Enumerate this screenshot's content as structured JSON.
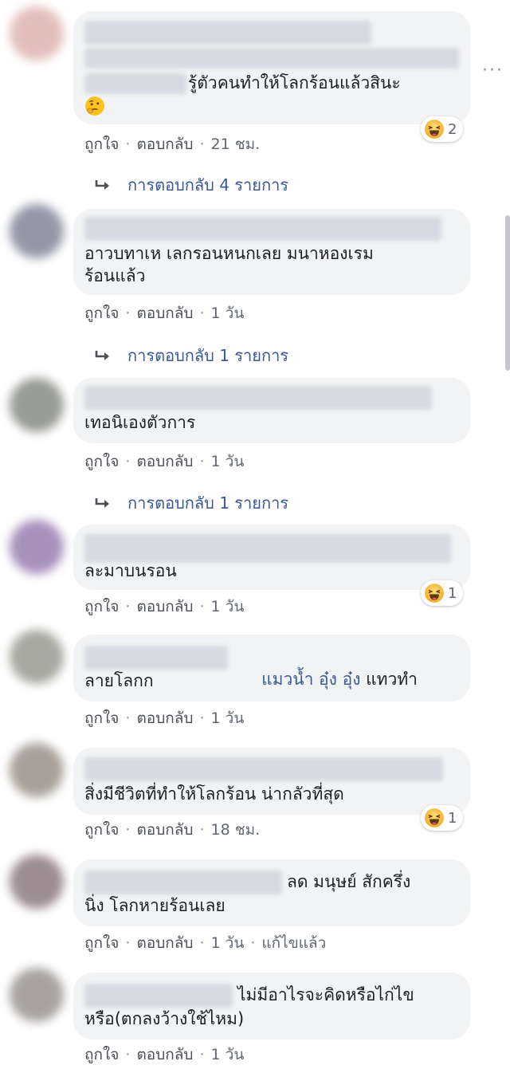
{
  "actions": {
    "like": "ถูกใจ",
    "reply": "ตอบกลับ",
    "separator": "·",
    "more": "···"
  },
  "comments": [
    {
      "text": "รู้ตัวคนทำให้โลกร้อนแล้วสินะ",
      "time": "21 ชม.",
      "reaction_count": "2",
      "replies": "การตอบกลับ 4 รายการ"
    },
    {
      "text": "อาวบทาเห เลกรอนหนกเลย มนาหองเรม\nร้อนแล้ว",
      "time": "1 วัน",
      "replies": "การตอบกลับ 1 รายการ"
    },
    {
      "text": "เทอนิเองตัวการ",
      "time": "1 วัน",
      "replies": "การตอบกลับ 1 รายการ"
    },
    {
      "text": "ละมาบนรอน",
      "time": "1 วัน",
      "reaction_count": "1"
    },
    {
      "mention": "แมวน้ำ อุ๋ง อุ๋ง",
      "text_after_mention": " แทวทำ",
      "text_line2": "ลายโลกก",
      "time": "1 วัน"
    },
    {
      "text": "สิ่งมีชีวิตที่ทำให้โลกร้อน น่ากลัวที่สุด",
      "time": "18 ชม.",
      "reaction_count": "1"
    },
    {
      "text_line1": "ลด มนุษย์ สักครึ่ง",
      "text_line2": "นิ่ง โลกหายร้อนเลย",
      "time": "1 วัน",
      "edited": "แก้ไขแล้ว"
    },
    {
      "text_line1": "ไม่มีอาไรจะคิดหรือไก่ไข",
      "text_line2": "หรือ(ตกลงว้างใช้ไหม)",
      "time": "1 วัน"
    }
  ],
  "colors": {
    "bubble": "#f2f3f5",
    "link": "#385898",
    "meta": "#606770",
    "reaction_emoji": "#f7b125"
  },
  "icons": {
    "reaction": "haha-emoji-icon",
    "inline_emoji": "thinking-emoji-icon",
    "reply_arrow": "reply-arrow-icon"
  }
}
